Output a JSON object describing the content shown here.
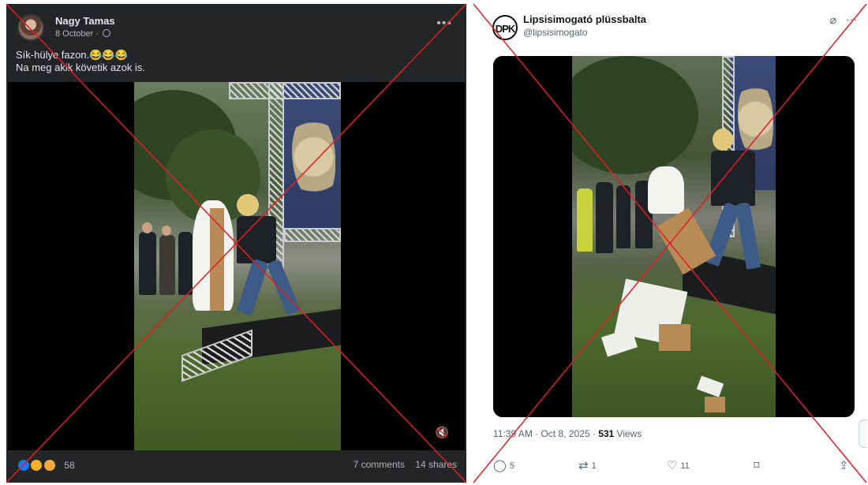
{
  "facebook_post": {
    "author": "Nagy Tamas",
    "date": "8 October",
    "privacy_icon": "globe-icon",
    "text_line1": "Sík-hülye fazon.😂😂😂",
    "text_line2": "Na meg akik követik azok is.",
    "reaction_icons": [
      "like-icon",
      "haha-icon",
      "sad-icon"
    ],
    "reaction_count": "58",
    "comments": "7 comments",
    "shares": "14 shares",
    "more_icon": "more-horizontal-icon",
    "mute_icon": "speaker-muted-icon"
  },
  "x_post": {
    "display_name": "Lipsisimogató plüssbalta",
    "handle": "@lipsisimogato",
    "avatar_text": "DPK",
    "grok_icon": "grok-icon",
    "more_icon": "more-horizontal-icon",
    "time": "11:39 AM · Oct 8, 2025 · ",
    "views_count": "531",
    "views_label": " Views",
    "actions": {
      "replies": "5",
      "reposts": "1",
      "likes": "11",
      "bookmark_icon": "bookmark-icon",
      "share_icon": "share-icon"
    }
  },
  "colors": {
    "fb_background": "#242526",
    "cross": "#e01f26",
    "x_text_secondary": "#536471"
  }
}
